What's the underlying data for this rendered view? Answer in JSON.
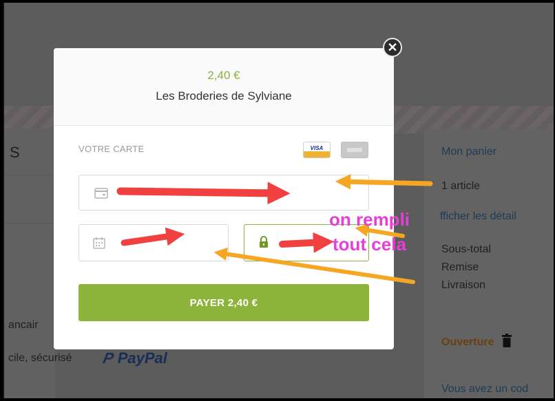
{
  "background": {
    "left_heading_fragment": "S",
    "bank_fragment": "ancair",
    "secure_fragment": "cile, sécurisé",
    "paypal": "PayPal"
  },
  "cart": {
    "title": "Mon panier",
    "count": "1 article",
    "details": "fficher les détail",
    "subtotal": "Sous-total",
    "discount": "Remise",
    "shipping": "Livraison",
    "ouverture": "Ouverture",
    "coupon": "Vous avez un cod"
  },
  "modal": {
    "price": "2,40 €",
    "shop": "Les Broderies de Sylviane",
    "card_label": "VOTRE CARTE",
    "visa_text": "VISA",
    "pay_button": "PAYER 2,40 €"
  },
  "annotations": {
    "line1": "on rempli",
    "line2": "tout cela"
  },
  "colors": {
    "accent_green": "#8cb43a",
    "arrow_red": "#f04040",
    "arrow_orange": "#f5a623",
    "annotation_magenta": "#e63fd8"
  },
  "icons": {
    "close": "close-icon",
    "card": "credit-card-icon",
    "calendar": "calendar-icon",
    "lock": "lock-icon",
    "trash": "trash-icon"
  }
}
